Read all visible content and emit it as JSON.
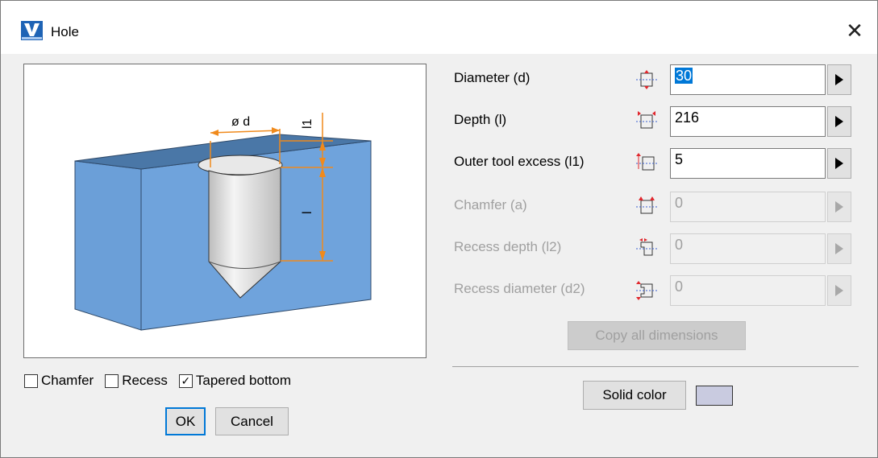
{
  "window": {
    "title": "Hole",
    "app_icon": "app-logo-icon",
    "close_icon": "close-icon",
    "close_glyph": "✕"
  },
  "preview": {
    "label_diameter": "ø d",
    "label_depth": "l",
    "label_excess": "l1"
  },
  "options": {
    "chamfer": {
      "label": "Chamfer",
      "checked": false
    },
    "recess": {
      "label": "Recess",
      "checked": false
    },
    "tapered": {
      "label": "Tapered bottom",
      "checked": true,
      "mark": "✓"
    }
  },
  "buttons": {
    "ok": "OK",
    "cancel": "Cancel",
    "copy_all": "Copy all dimensions",
    "solid_color": "Solid color"
  },
  "fields": [
    {
      "label": "Diameter (d)",
      "value": "30",
      "enabled": true,
      "selected": true,
      "icon": "diameter-icon"
    },
    {
      "label": "Depth (l)",
      "value": "216",
      "enabled": true,
      "selected": false,
      "icon": "depth-icon"
    },
    {
      "label": "Outer tool excess (l1)",
      "value": "5",
      "enabled": true,
      "selected": false,
      "icon": "outer-excess-icon"
    },
    {
      "label": "Chamfer (a)",
      "value": "0",
      "enabled": false,
      "selected": false,
      "icon": "chamfer-icon"
    },
    {
      "label": "Recess depth (l2)",
      "value": "0",
      "enabled": false,
      "selected": false,
      "icon": "recess-depth-icon"
    },
    {
      "label": "Recess diameter (d2)",
      "value": "0",
      "enabled": false,
      "selected": false,
      "icon": "recess-diameter-icon"
    }
  ],
  "colors": {
    "solid_color": "#c9cbe0",
    "block_front": "#6fa3dc",
    "block_top": "#4f7aa6",
    "dimension_lines": "#f08a1c",
    "focus": "#0078d7"
  }
}
